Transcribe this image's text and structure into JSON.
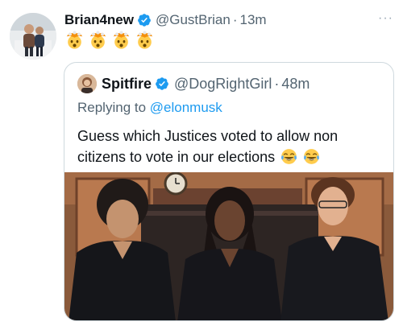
{
  "tweet": {
    "display_name": "Brian4new",
    "handle": "@GustBrian",
    "separator": "·",
    "time": "13m",
    "more_label": "···",
    "emoji_icons": [
      "exploding-head-icon",
      "exploding-head-icon",
      "exploding-head-icon",
      "exploding-head-icon"
    ]
  },
  "quote": {
    "display_name": "Spitfire",
    "handle": "@DogRightGirl",
    "separator": "·",
    "time": "48m",
    "reply_prefix": "Replying to ",
    "reply_mention": "@elonmusk",
    "text": "Guess which Justices voted to allow non citizens to vote in our elections",
    "text_emoji_icons": [
      "tears-of-joy-icon",
      "tears-of-joy-icon"
    ]
  },
  "colors": {
    "verified_blue": "#1d9bf0",
    "secondary_text": "#536471",
    "link_blue": "#1d9bf0",
    "card_border": "#cfd9de"
  }
}
